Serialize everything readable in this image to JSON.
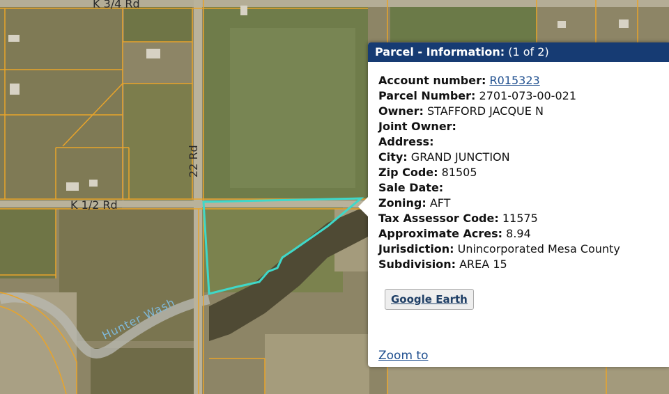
{
  "map": {
    "roads": {
      "k34": "K 3/4 Rd",
      "k12": "K 1/2 Rd",
      "r22": "22 Rd"
    },
    "wash": "Hunter Wash",
    "colors": {
      "parcel_line": "#e9a42a",
      "selected_parcel": "#3fd8c9"
    }
  },
  "popup": {
    "title": "Parcel - Information:",
    "counter": "(1 of 2)",
    "fields": [
      {
        "label": "Account number:",
        "value": "R015323",
        "link": true
      },
      {
        "label": "Parcel Number:",
        "value": "2701-073-00-021"
      },
      {
        "label": "Owner:",
        "value": "STAFFORD JACQUE N"
      },
      {
        "label": "Joint Owner:",
        "value": ""
      },
      {
        "label": "Address:",
        "value": ""
      },
      {
        "label": "City:",
        "value": "GRAND JUNCTION"
      },
      {
        "label": "Zip Code:",
        "value": "81505"
      },
      {
        "label": "Sale Date:",
        "value": ""
      },
      {
        "label": "Zoning:",
        "value": "AFT"
      },
      {
        "label": "Tax Assessor Code:",
        "value": "11575"
      },
      {
        "label": "Approximate Acres:",
        "value": "8.94"
      },
      {
        "label": "Jurisdiction:",
        "value": "Unincorporated Mesa County"
      },
      {
        "label": "Subdivision:",
        "value": "AREA 15"
      }
    ],
    "google_earth_label": "Google Earth",
    "zoom_label": "Zoom to"
  }
}
